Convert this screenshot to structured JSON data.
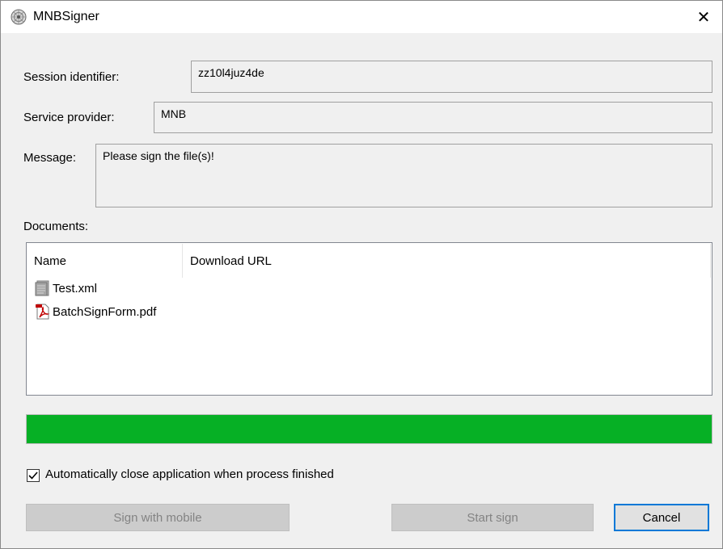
{
  "window": {
    "title": "MNBSigner",
    "close_glyph": "✕"
  },
  "session": {
    "label": "Session identifier:",
    "value": "zz10l4juz4de"
  },
  "provider": {
    "label": "Service provider:",
    "value": "MNB"
  },
  "message": {
    "label": "Message:",
    "value": "Please sign the file(s)!"
  },
  "documents": {
    "label": "Documents:",
    "columns": [
      "Name",
      "Download URL"
    ],
    "rows": [
      {
        "name": "Test.xml",
        "icon": "xml-file-icon"
      },
      {
        "name": "BatchSignForm.pdf",
        "icon": "pdf-file-icon"
      }
    ]
  },
  "progress": {
    "fraction": 1.0,
    "color": "#06b025"
  },
  "auto_close": {
    "label": "Automatically close application when process finished",
    "checked": true
  },
  "buttons": {
    "mobile": "Sign with mobile",
    "start": "Start sign",
    "cancel": "Cancel"
  }
}
